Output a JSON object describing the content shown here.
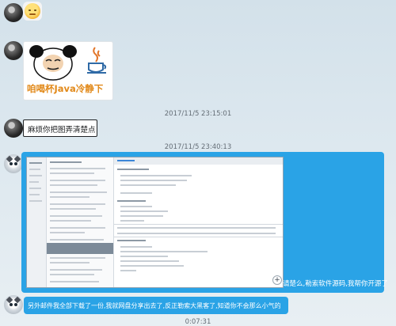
{
  "messages": {
    "sticker_caption": "咱喝杯Java冷静下",
    "time1": "2017/11/5 23:15:01",
    "request_text": "麻烦你把图弄清楚点",
    "time2": "2017/11/5 23:40:13",
    "reply_text": "请楚么,勒索软件源码,我帮你开源了",
    "final_text": "另外邮件我全部下载了一份,我就网盘分享出去了,反正勒索大黑客了,知道你不会那么小气的",
    "time3": "0:07:31"
  },
  "colors": {
    "bubble": "#2aa3e6",
    "timestamp": "#646d76",
    "caption_orange": "#e28a1b"
  },
  "icons": [
    "avatar-dark",
    "avatar-cat",
    "panda-meme",
    "java-cup-icon"
  ]
}
